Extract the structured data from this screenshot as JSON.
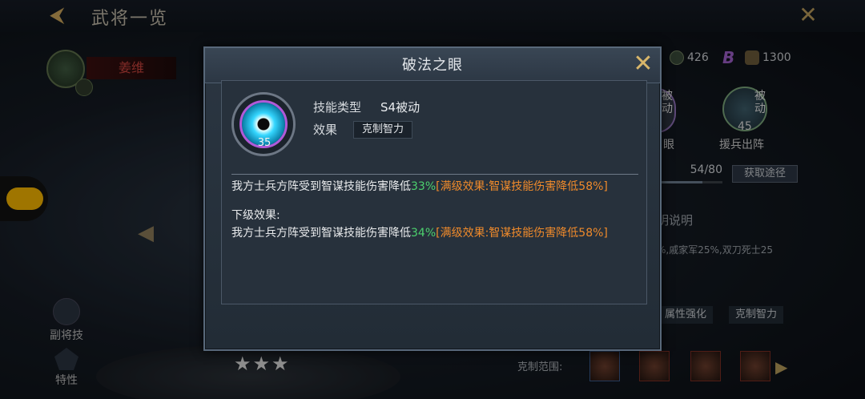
{
  "header": {
    "title": "武将一览"
  },
  "hero": {
    "name": "姜维"
  },
  "resources": [
    {
      "icon": "shield-coin-icon",
      "value": "426"
    },
    {
      "icon": "b-gem-icon",
      "value": ""
    },
    {
      "icon": "bag-icon",
      "value": "1300"
    }
  ],
  "right_panel": {
    "skill1_badge": "被动",
    "skill1_name": "眼",
    "skill2_badge": "被动",
    "skill2_level": "45",
    "skill2_name": "援兵出阵",
    "progress": "54/80",
    "progress_fraction": 0.675,
    "get_button": "获取途径",
    "desc_title": "明说明",
    "desc_text": "%,戚家军25%,双刀死士25",
    "tags": [
      "属性强化",
      "克制智力"
    ],
    "counter_label": "克制范围:"
  },
  "left_panel": {
    "skill_label": "副将技",
    "trait_label": "特性",
    "stars": "★★★"
  },
  "modal": {
    "title": "破法之眼",
    "skill_level": "35",
    "type_label": "技能类型",
    "type_value": "S4被动",
    "effect_label": "效果",
    "effect_tag": "克制智力",
    "desc1": {
      "prefix": "我方士兵方阵受到智谋技能伤害降低",
      "pct": "33%",
      "max": "[满级效果:智谋技能伤害降低58%]"
    },
    "next_label": "下级效果:",
    "desc2": {
      "prefix": "我方士兵方阵受到智谋技能伤害降低",
      "pct": "34%",
      "max": "[满级效果:智谋技能伤害降低58%]"
    }
  },
  "colors": {
    "accent_gold": "#d8b66a",
    "pct_green": "#4cd06d",
    "max_orange": "#ef8a2b",
    "hero_red": "#c7433c"
  }
}
